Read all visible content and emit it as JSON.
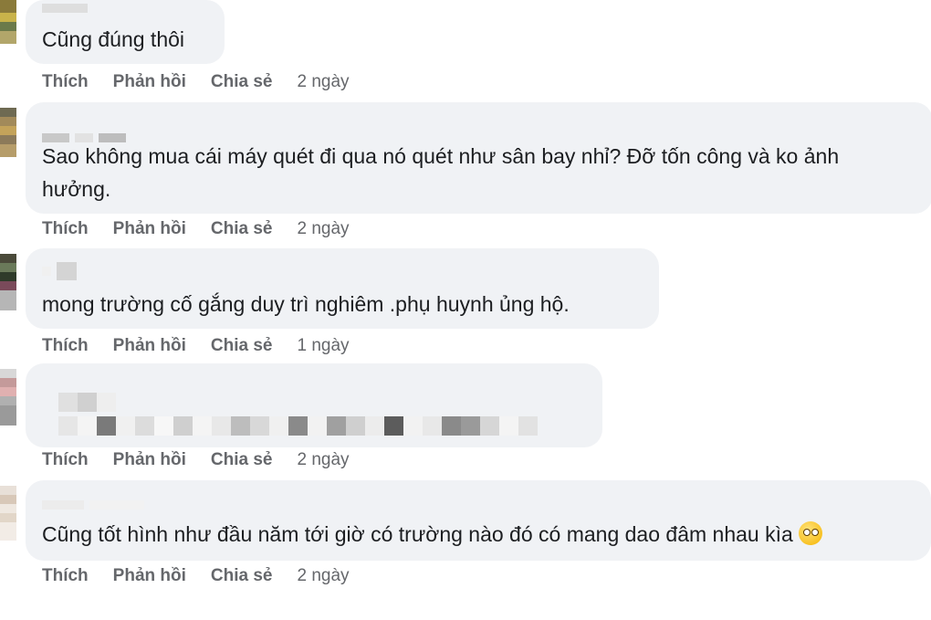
{
  "comments": [
    {
      "text_lines": [
        "Cũng đúng thôi"
      ],
      "time": "2 ngày"
    },
    {
      "text_lines": [
        "Sao không mua cái máy quét đi qua nó quét như sân bay nhỉ? Đỡ tốn công và ko ảnh",
        "hưởng."
      ],
      "time": "2 ngày"
    },
    {
      "text_lines": [
        "mong trường cố gắng duy trì nghiêm .phụ huynh ủng hộ."
      ],
      "time": "1 ngày"
    },
    {
      "text_lines": [],
      "time": "2 ngày",
      "redacted": true
    },
    {
      "text_lines": [
        "Cũng tốt hình như đầu năm tới giờ có trường nào đó có mang dao đâm nhau kìa"
      ],
      "time": "2 ngày",
      "emoji": "face-with-rolling-eyes-icon"
    }
  ],
  "actions": {
    "like": "Thích",
    "reply": "Phản hồi",
    "share": "Chia sẻ"
  },
  "colors": {
    "bubble": "#f0f2f5",
    "text": "#1c1e21",
    "meta": "#65676b"
  }
}
